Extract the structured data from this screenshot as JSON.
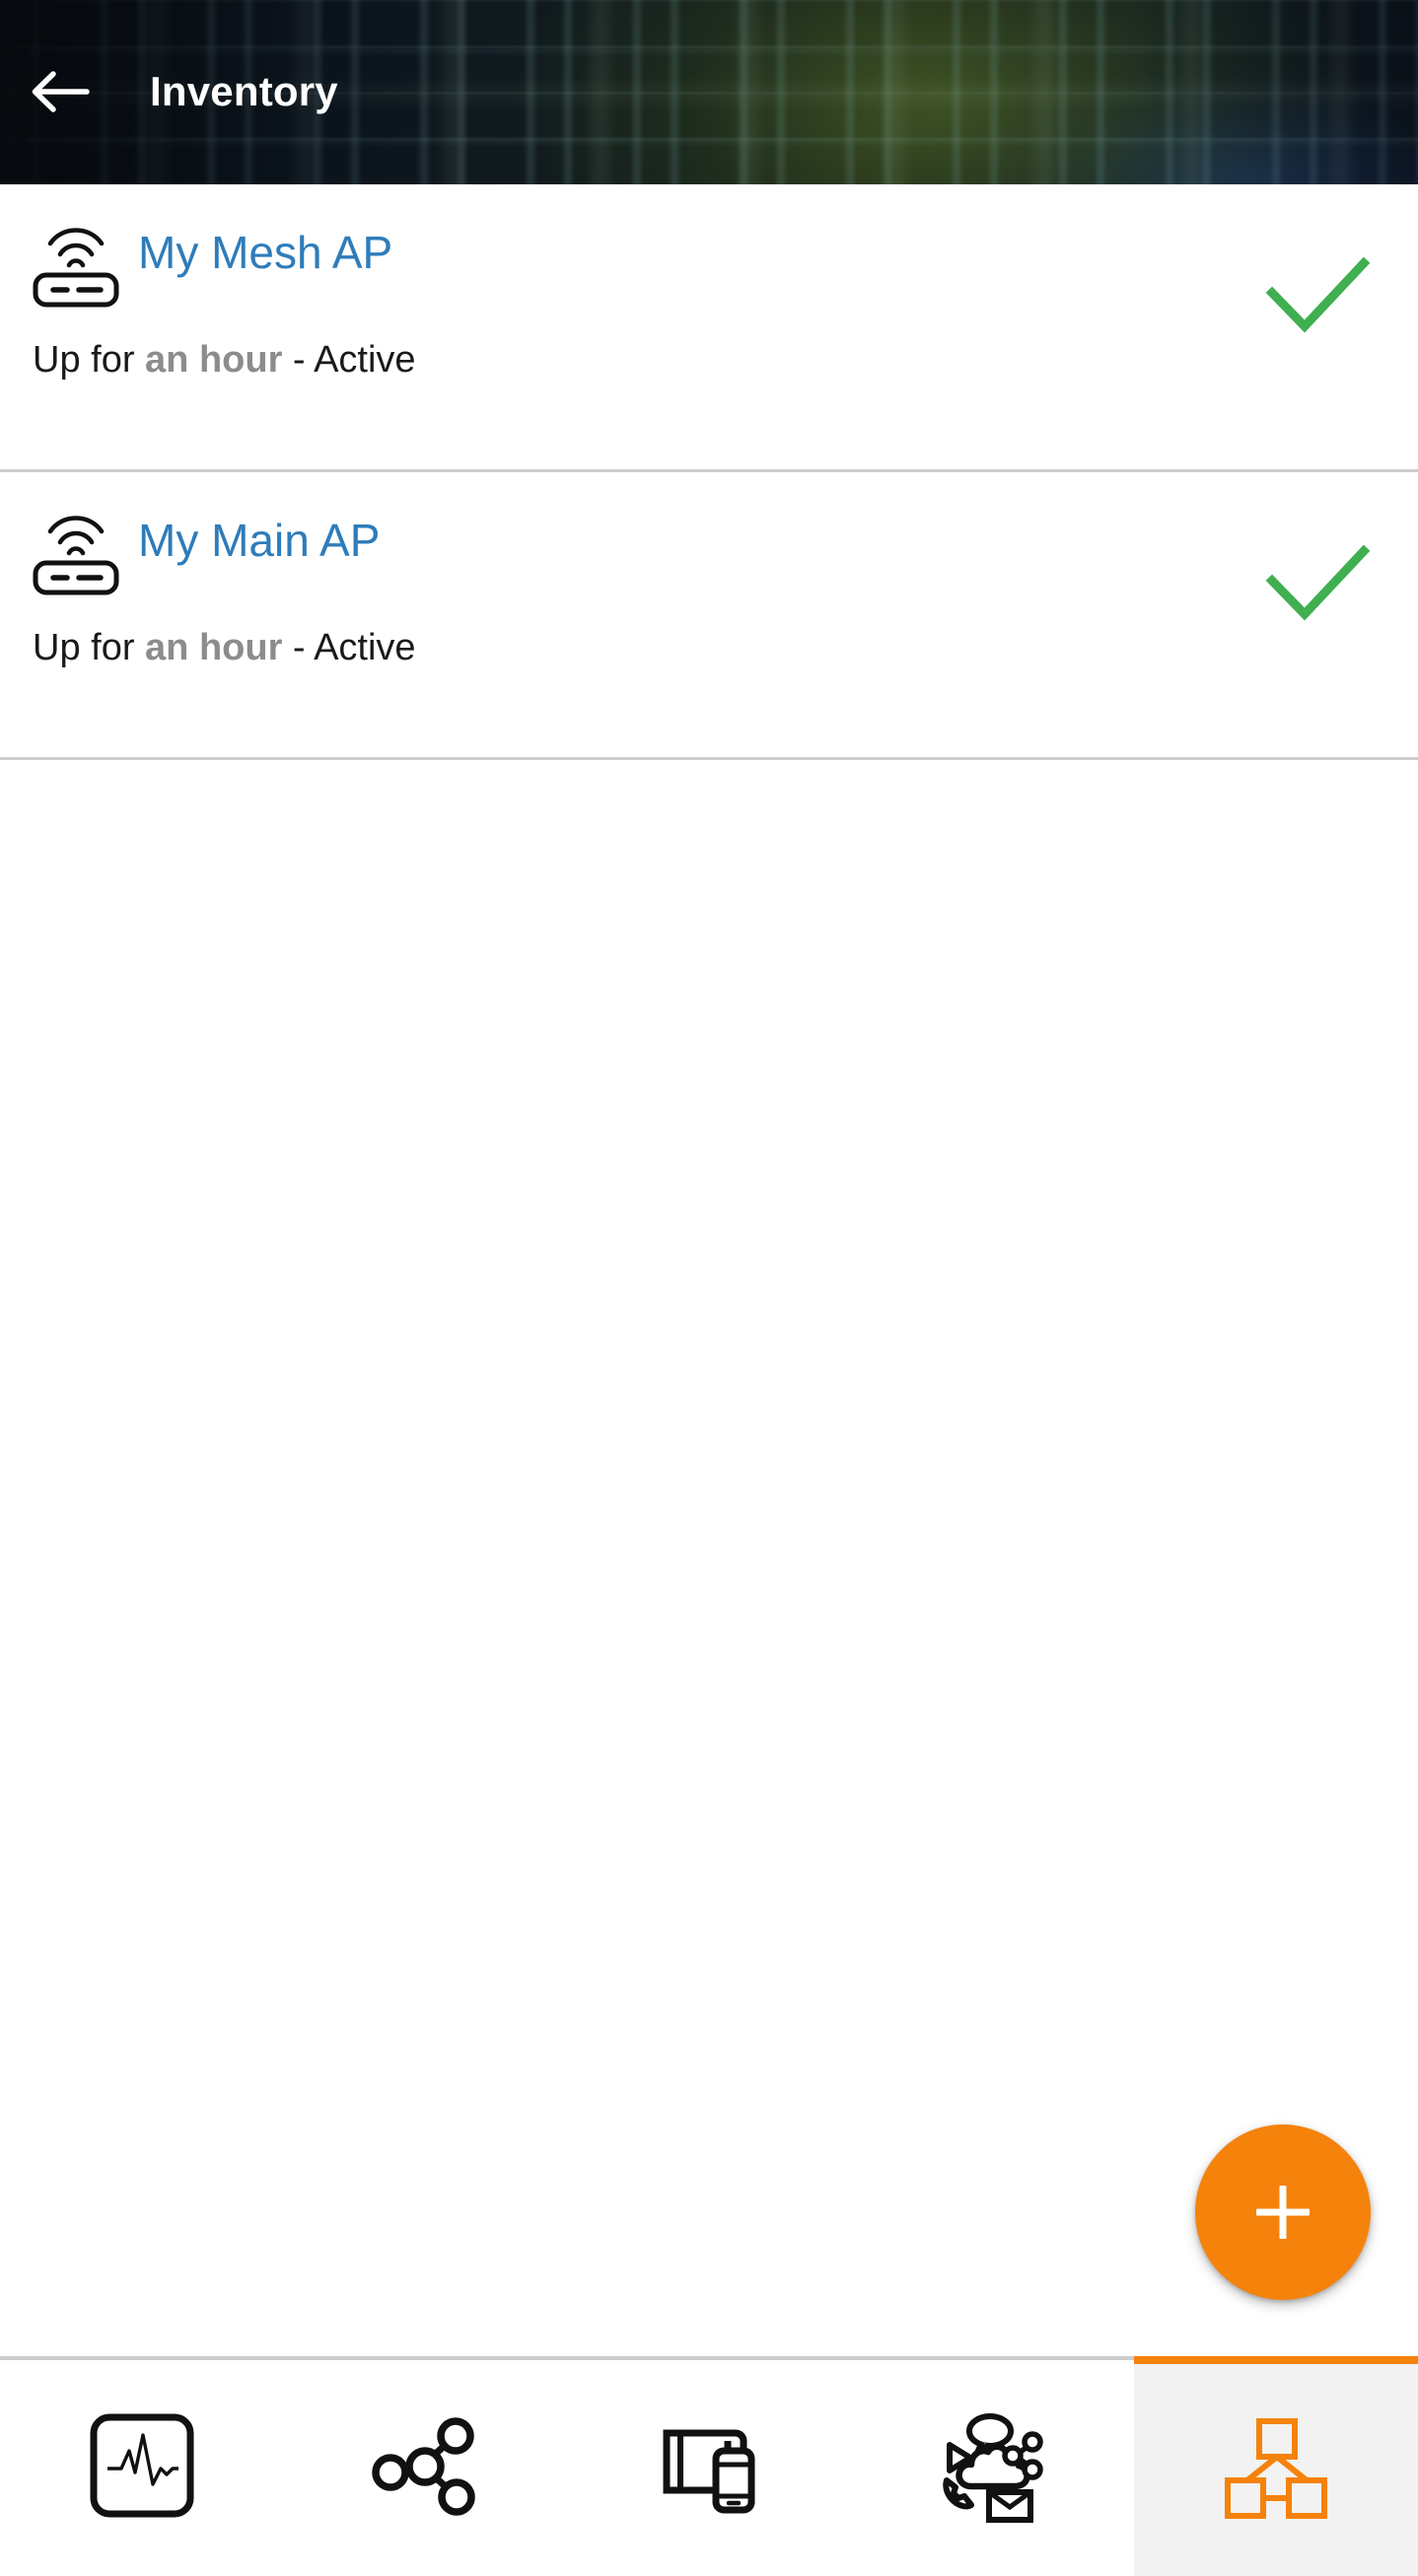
{
  "header": {
    "title": "Inventory",
    "back_icon": "arrow-left-icon",
    "background_style": "dark-digital-display-photo",
    "background_color": "#0d1620",
    "title_color": "#ffffff"
  },
  "colors": {
    "accent_orange": "#f5820b",
    "link_blue": "#2e7cba",
    "status_green": "#3faf50",
    "divider_gray": "#cdcdcd",
    "muted_gray": "#8c8c8c",
    "active_tab_bg": "#f2f2f2"
  },
  "inventory": {
    "items": [
      {
        "icon": "access-point-icon",
        "name": "My Mesh AP",
        "uptime_prefix": "Up for ",
        "uptime_value": "an hour",
        "status_separator": " - ",
        "status": "Active",
        "status_icon": "check-icon",
        "status_icon_color": "#3faf50"
      },
      {
        "icon": "access-point-icon",
        "name": "My Main AP",
        "uptime_prefix": "Up for ",
        "uptime_value": "an hour",
        "status_separator": " - ",
        "status": "Active",
        "status_icon": "check-icon",
        "status_icon_color": "#3faf50"
      }
    ]
  },
  "fab": {
    "icon": "plus-icon",
    "label": "+",
    "color": "#f5820b"
  },
  "bottom_nav": {
    "active_index": 4,
    "items": [
      {
        "icon": "monitoring-waveform-icon",
        "label": ""
      },
      {
        "icon": "network-topology-icon",
        "label": ""
      },
      {
        "icon": "devices-icon",
        "label": ""
      },
      {
        "icon": "applications-cloud-icon",
        "label": ""
      },
      {
        "icon": "inventory-hierarchy-icon",
        "label": ""
      }
    ]
  }
}
